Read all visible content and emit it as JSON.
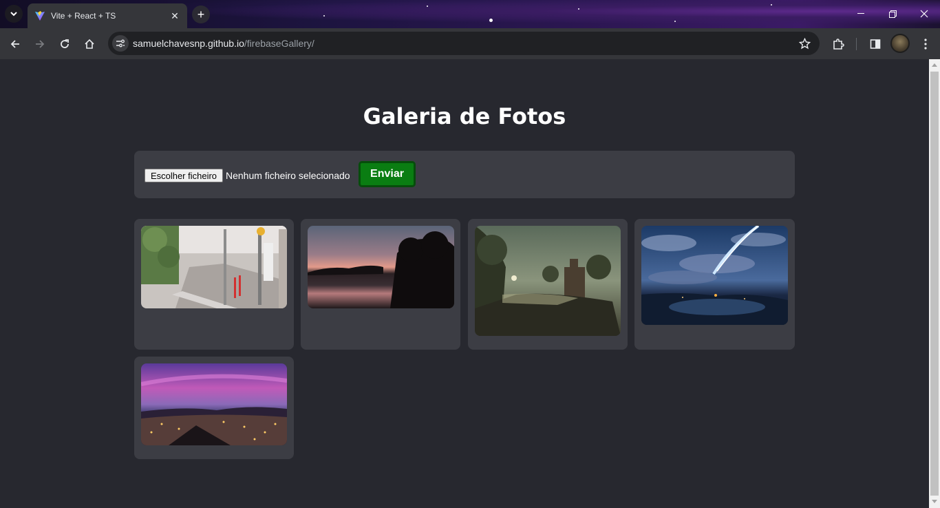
{
  "browser": {
    "tab_title": "Vite + React + TS",
    "url_host": "samuelchavesnp.github.io",
    "url_path": "/firebaseGallery/"
  },
  "page": {
    "title": "Galeria de Fotos",
    "file_button_label": "Escolher ficheiro",
    "file_status": "Nenhum ficheiro selecionado",
    "send_label": "Enviar"
  },
  "gallery": [
    {
      "description": "street"
    },
    {
      "description": "sunset lake"
    },
    {
      "description": "castle painting"
    },
    {
      "description": "comet sky"
    },
    {
      "description": "city night"
    }
  ],
  "colors": {
    "background": "#27282f",
    "panel": "#3c3d44",
    "send_button": "#0a7d12"
  }
}
